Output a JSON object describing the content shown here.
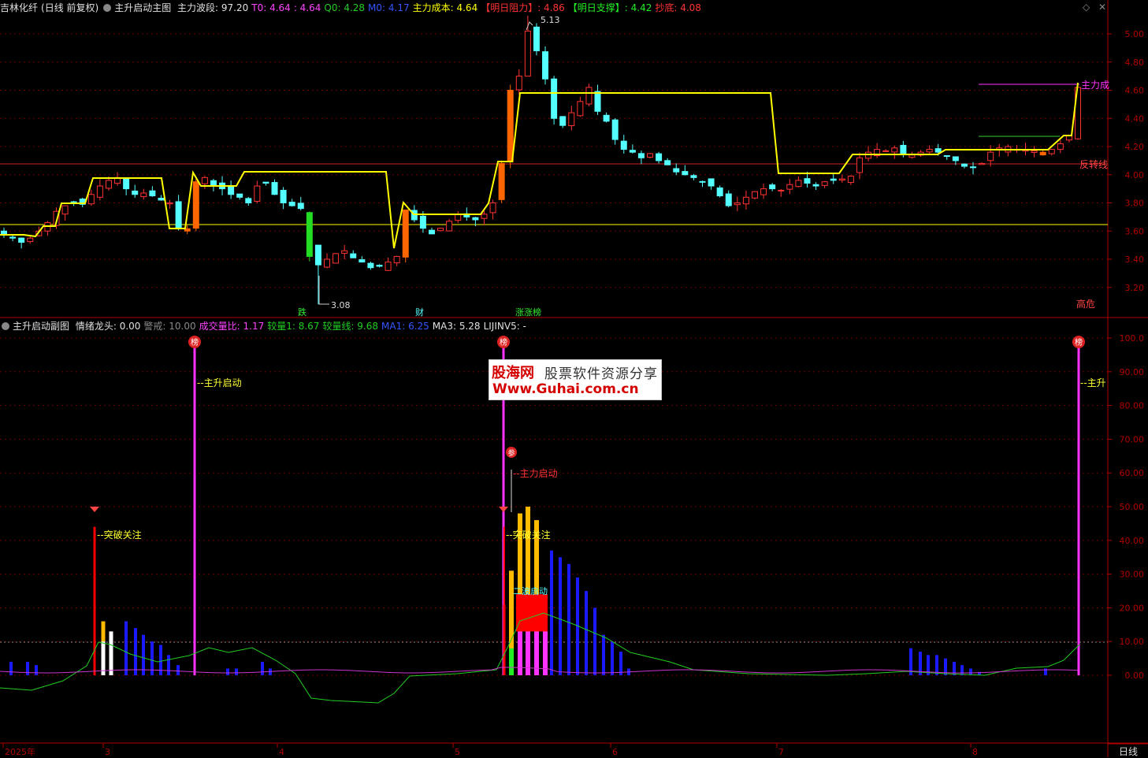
{
  "header": {
    "stock": "吉林化纤",
    "mode": "(日线 前复权)",
    "main_indicator": "主升启动主图",
    "items": [
      {
        "label": "主力波段: 97.20",
        "color": "#e0e0e0"
      },
      {
        "label": "T0: 4.64",
        "color": "#ff44ff"
      },
      {
        "label": ": 4.64",
        "color": "#ff44ff"
      },
      {
        "label": "Q0: 4.28",
        "color": "#22cc22"
      },
      {
        "label": "M0: 4.17",
        "color": "#3355ff"
      },
      {
        "label": "主力成本: 4.64",
        "color": "#ffff00"
      },
      {
        "label": "【明日阻力】: 4.86",
        "color": "#ff3333"
      },
      {
        "label": "【明日支撑】: 4.42",
        "color": "#22ee22"
      },
      {
        "label": "抄底: 4.08",
        "color": "#ff3333"
      }
    ]
  },
  "sub_header": {
    "indicator": "主升启动副图",
    "items": [
      {
        "label": "情绪龙头: 0.00",
        "color": "#e0e0e0"
      },
      {
        "label": "警戒: 10.00",
        "color": "#888888"
      },
      {
        "label": "成交量比: 1.17",
        "color": "#ff44ff"
      },
      {
        "label": "较量1: 8.67",
        "color": "#22cc22"
      },
      {
        "label": "较量线: 9.68",
        "color": "#22cc22"
      },
      {
        "label": "MA1: 6.25",
        "color": "#3355ff"
      },
      {
        "label": "MA3: 5.28",
        "color": "#e0e0e0"
      },
      {
        "label": "LIJINV5: -",
        "color": "#e0e0e0"
      }
    ]
  },
  "axes": {
    "main_ticks": [
      "5.00",
      "4.80",
      "4.60",
      "4.40",
      "4.20",
      "4.00",
      "3.80",
      "3.60",
      "3.40",
      "3.20"
    ],
    "sub_ticks": [
      "100.0",
      "90.00",
      "80.00",
      "70.00",
      "60.00",
      "50.00",
      "40.00",
      "30.00",
      "20.00",
      "10.00",
      "0.00"
    ],
    "x_labels": [
      "2025年",
      "3",
      "4",
      "5",
      "6",
      "7",
      "8"
    ],
    "period": "日线"
  },
  "annotations": {
    "high": "5.13",
    "low": "3.08",
    "zhuli_cheng": "主力成",
    "fanzhuan": "反转线",
    "gaowei": "高危",
    "bottom_tags": [
      "跌",
      "财",
      "涨涨榜"
    ],
    "zhusheng": "主升启动",
    "zhusheng_cut": "主升",
    "tupo": "突破关注",
    "zhuli_qidong": "主力启动",
    "second": "二波启动",
    "bang": "榜",
    "can": "参"
  },
  "watermark": {
    "brand": "股海网",
    "slogan": "股票软件资源分享",
    "url": "Www.Guhai.com.cn"
  },
  "colors": {
    "up": "#ff3333",
    "down": "#54ffff",
    "line": "#ffff00",
    "axis": "#b00000",
    "magenta": "#ff33ff",
    "green": "#33dd33",
    "blue": "#1a1aff",
    "orange": "#ff6600"
  }
}
